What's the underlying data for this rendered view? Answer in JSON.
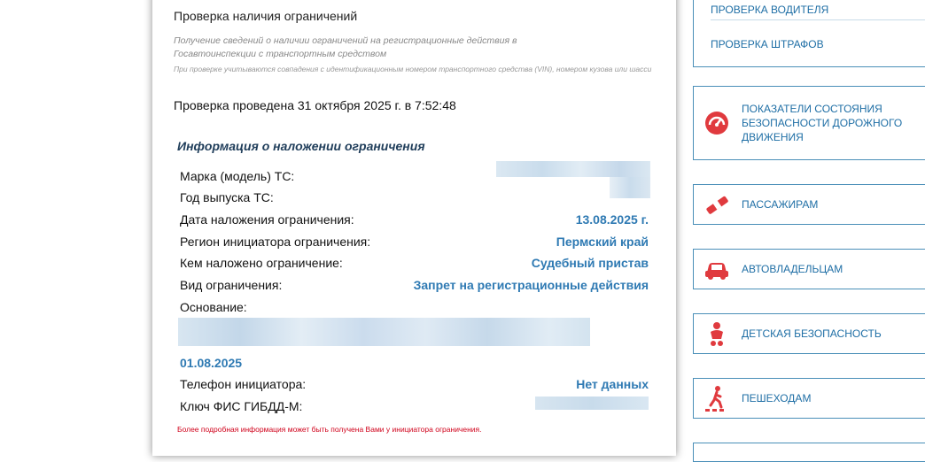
{
  "check": {
    "title": "Проверка наличия ограничений",
    "description": "Получение сведений о наличии ограничений на регистрационные действия в Госавтоинспекции с транспортным средством",
    "note": "При проверке учитываются совпадения с идентификационным номером транспортного средства (VIN), номером кузова или шасси",
    "performed": "Проверка проведена 31 октября 2025 г. в 7:52:48"
  },
  "restriction": {
    "section_title": "Информация о наложении ограничения",
    "rows": [
      {
        "label": "Марка (модель) ТС:",
        "value": ""
      },
      {
        "label": "Год выпуска ТС:",
        "value": ""
      },
      {
        "label": "Дата наложения ограничения:",
        "value": "13.08.2025 г."
      },
      {
        "label": "Регион инициатора ограничения:",
        "value": "Пермский край"
      },
      {
        "label": "Кем наложено ограничение:",
        "value": "Судебный пристав"
      },
      {
        "label": "Вид ограничения:",
        "value": "Запрет на регистрационные действия"
      },
      {
        "label": "Основание:",
        "value": ""
      }
    ],
    "basis_date": "01.08.2025",
    "phone_label": "Телефон инициатора:",
    "phone_value": "Нет данных",
    "fis_label": "Ключ ФИС ГИБДД-М:",
    "footer_note": "Более подробная информация может быть получена Вами у инициатора ограничения."
  },
  "sidebar": {
    "links": [
      "ПРОВЕРКА ВОДИТЕЛЯ",
      "ПРОВЕРКА ШТРАФОВ"
    ],
    "items": [
      {
        "label": "ПОКАЗАТЕЛИ СОСТОЯНИЯ БЕЗОПАСНОСТИ ДОРОЖНОГО ДВИЖЕНИЯ",
        "icon": "speedometer-icon"
      },
      {
        "label": "ПАССАЖИРАМ",
        "icon": "seatbelt-icon"
      },
      {
        "label": "АВТОВЛАДЕЛЬЦАМ",
        "icon": "car-icon"
      },
      {
        "label": "ДЕТСКАЯ БЕЗОПАСНОСТЬ",
        "icon": "child-icon"
      },
      {
        "label": "ПЕШЕХОДАМ",
        "icon": "pedestrian-icon"
      }
    ]
  },
  "colors": {
    "accent": "#2f7ab3",
    "icon_red": "#e03a3e",
    "nav_text": "#1e6ea5",
    "note_red": "#d0021b"
  }
}
